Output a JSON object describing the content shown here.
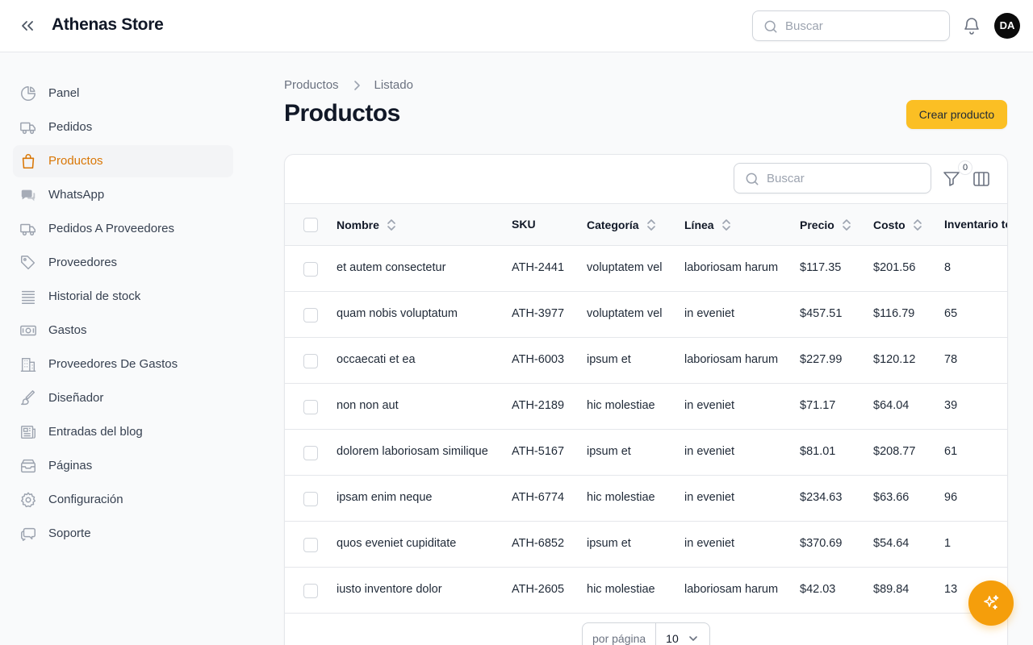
{
  "app": {
    "title": "Athenas Store"
  },
  "header": {
    "search_placeholder": "Buscar",
    "avatar_initials": "DA"
  },
  "sidebar": {
    "items": [
      {
        "label": "Panel",
        "icon": "chart-pie-icon",
        "active": false
      },
      {
        "label": "Pedidos",
        "icon": "truck-icon",
        "active": false
      },
      {
        "label": "Productos",
        "icon": "shopping-bag-icon",
        "active": true
      },
      {
        "label": "WhatsApp",
        "icon": "chat-bubbles-icon",
        "active": false
      },
      {
        "label": "Pedidos A Proveedores",
        "icon": "truck-icon",
        "active": false
      },
      {
        "label": "Proveedores",
        "icon": "tag-icon",
        "active": false
      },
      {
        "label": "Historial de stock",
        "icon": "queue-list-icon",
        "active": false
      },
      {
        "label": "Gastos",
        "icon": "banknotes-icon",
        "active": false
      },
      {
        "label": "Proveedores De Gastos",
        "icon": "building-icon",
        "active": false
      },
      {
        "label": "Diseñador",
        "icon": "paint-brush-icon",
        "active": false
      },
      {
        "label": "Entradas del blog",
        "icon": "newspaper-icon",
        "active": false
      },
      {
        "label": "Páginas",
        "icon": "inbox-stack-icon",
        "active": false
      },
      {
        "label": "Configuración",
        "icon": "cog-icon",
        "active": false
      },
      {
        "label": "Soporte",
        "icon": "chat-support-icon",
        "active": false
      }
    ]
  },
  "main": {
    "breadcrumb": [
      "Productos",
      "Listado"
    ],
    "title": "Productos",
    "create_button": "Crear producto"
  },
  "table": {
    "search_placeholder": "Buscar",
    "filter_count": "0",
    "columns": [
      "Nombre",
      "SKU",
      "Categoría",
      "Línea",
      "Precio",
      "Costo",
      "Inventario te"
    ],
    "rows": [
      [
        "et autem consectetur",
        "ATH-2441",
        "voluptatem vel",
        "laboriosam harum",
        "$117.35",
        "$201.56",
        "8"
      ],
      [
        "quam nobis voluptatum",
        "ATH-3977",
        "voluptatem vel",
        "in eveniet",
        "$457.51",
        "$116.79",
        "65"
      ],
      [
        "occaecati et ea",
        "ATH-6003",
        "ipsum et",
        "laboriosam harum",
        "$227.99",
        "$120.12",
        "78"
      ],
      [
        "non non aut",
        "ATH-2189",
        "hic molestiae",
        "in eveniet",
        "$71.17",
        "$64.04",
        "39"
      ],
      [
        "dolorem laboriosam similique",
        "ATH-5167",
        "ipsum et",
        "in eveniet",
        "$81.01",
        "$208.77",
        "61"
      ],
      [
        "ipsam enim neque",
        "ATH-6774",
        "hic molestiae",
        "in eveniet",
        "$234.63",
        "$63.66",
        "96"
      ],
      [
        "quos eveniet cupiditate",
        "ATH-6852",
        "ipsum et",
        "in eveniet",
        "$370.69",
        "$54.64",
        "1"
      ],
      [
        "iusto inventore dolor",
        "ATH-2605",
        "hic molestiae",
        "laboriosam harum",
        "$42.03",
        "$89.84",
        "13"
      ]
    ],
    "per_page_label": "por página",
    "per_page_value": "10"
  },
  "colors": {
    "accent": "#d97706",
    "button": "#fbbf24",
    "fab": "#f59e0b"
  }
}
